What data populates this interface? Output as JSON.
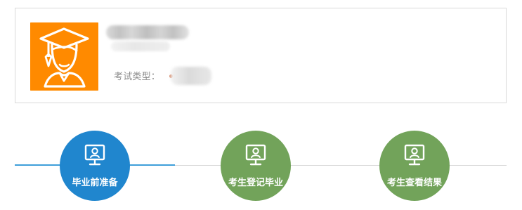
{
  "profile": {
    "avatar_icon": "graduate-user-icon",
    "exam_type_label": "考试类型："
  },
  "steps": [
    {
      "label": "毕业前准备",
      "icon": "monitor-user-icon",
      "status": "active",
      "color": "#2086ce"
    },
    {
      "label": "考生登记毕业",
      "icon": "monitor-user-icon",
      "status": "inactive",
      "color": "#72a35a"
    },
    {
      "label": "考生查看结果",
      "icon": "monitor-user-icon",
      "status": "inactive",
      "color": "#72a35a"
    }
  ],
  "colors": {
    "avatar_orange": "#ff8a00",
    "active_blue": "#2086ce",
    "step_green": "#72a35a",
    "line_gray": "#d9d9d9",
    "progress_blue": "#3e9fda"
  }
}
